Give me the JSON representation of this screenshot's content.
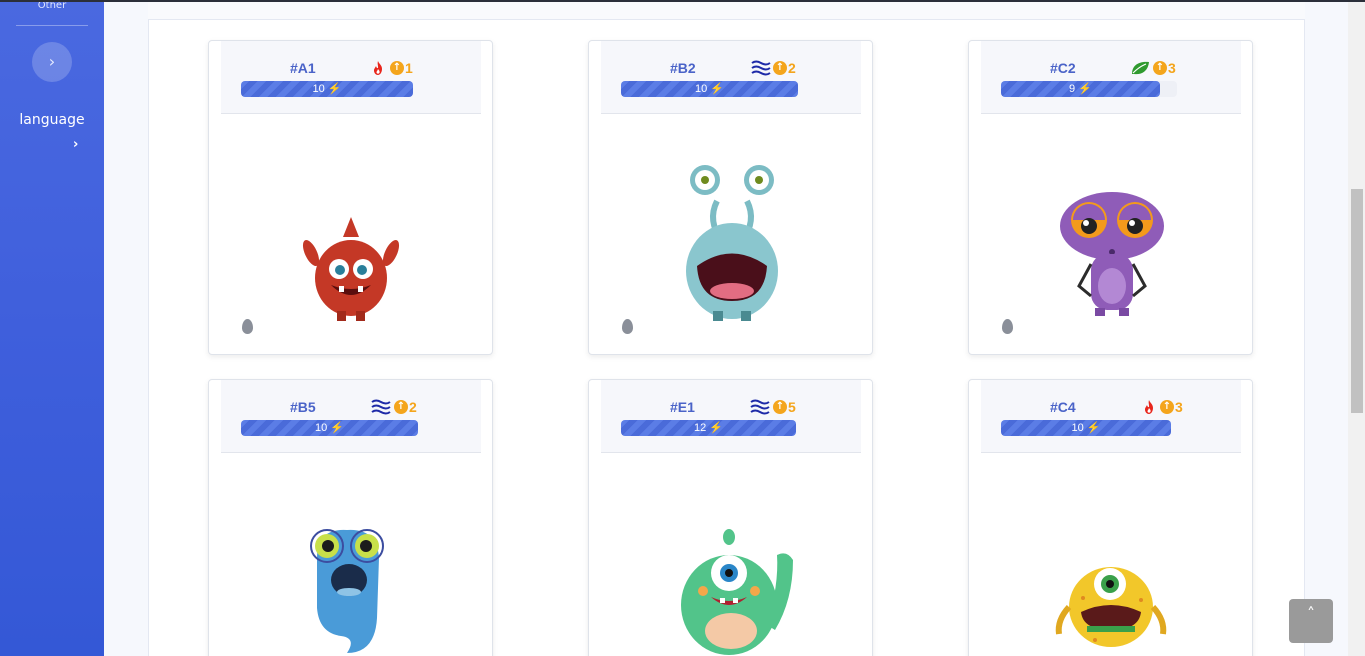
{
  "sidebar": {
    "other_label": "Other",
    "toggle_icon": "chevron-right-icon",
    "language_label": "language",
    "language_arrow": "›"
  },
  "cards": [
    {
      "id": "#A1",
      "element": "fire",
      "level": "1",
      "energy": "10",
      "energy_fraction": 1.0
    },
    {
      "id": "#B2",
      "element": "water",
      "level": "2",
      "energy": "10",
      "energy_fraction": 1.0
    },
    {
      "id": "#C2",
      "element": "leaf",
      "level": "3",
      "energy": "9",
      "energy_fraction": 0.9
    },
    {
      "id": "#B5",
      "element": "water",
      "level": "2",
      "energy": "10",
      "energy_fraction": 1.0
    },
    {
      "id": "#E1",
      "element": "water",
      "level": "5",
      "energy": "12",
      "energy_fraction": 1.0
    },
    {
      "id": "#C4",
      "element": "fire",
      "level": "3",
      "energy": "10",
      "energy_fraction": 1.0
    }
  ],
  "colors": {
    "sidebar": "#3f5fdc",
    "accent": "#4a63c8",
    "level": "#f4a51c",
    "fire": "#e8261c",
    "water": "#1e2aa8",
    "leaf": "#2f9a2f"
  },
  "back_to_top": "˄"
}
